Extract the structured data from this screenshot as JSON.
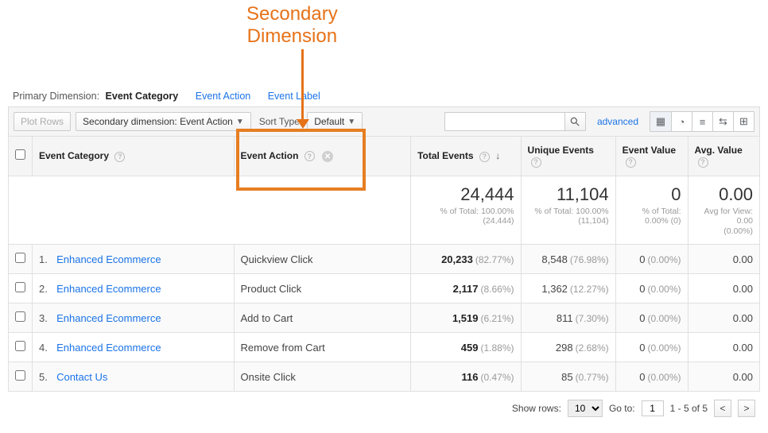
{
  "annotation": {
    "line1": "Secondary",
    "line2": "Dimension"
  },
  "primary": {
    "label": "Primary Dimension:",
    "active": "Event Category",
    "options": [
      "Event Action",
      "Event Label"
    ]
  },
  "toolbar": {
    "plot_rows": "Plot Rows",
    "secondary_dim": "Secondary dimension: Event Action",
    "sort_label": "Sort Type:",
    "sort_value": "Default",
    "search_placeholder": "",
    "advanced": "advanced"
  },
  "columns": [
    "Event Category",
    "Event Action",
    "Total Events",
    "Unique Events",
    "Event Value",
    "Avg. Value"
  ],
  "totals": {
    "total_events": {
      "value": "24,444",
      "sub1": "% of Total: 100.00%",
      "sub2": "(24,444)"
    },
    "unique_events": {
      "value": "11,104",
      "sub1": "% of Total: 100.00%",
      "sub2": "(11,104)"
    },
    "event_value": {
      "value": "0",
      "sub1": "% of Total:",
      "sub2": "0.00% (0)"
    },
    "avg_value": {
      "value": "0.00",
      "sub1": "Avg for View: 0.00",
      "sub2": "(0.00%)"
    }
  },
  "rows": [
    {
      "idx": "1.",
      "category": "Enhanced Ecommerce",
      "action": "Quickview Click",
      "total": "20,233",
      "total_pct": "(82.77%)",
      "unique": "8,548",
      "unique_pct": "(76.98%)",
      "ev": "0",
      "ev_pct": "(0.00%)",
      "avg": "0.00"
    },
    {
      "idx": "2.",
      "category": "Enhanced Ecommerce",
      "action": "Product Click",
      "total": "2,117",
      "total_pct": "(8.66%)",
      "unique": "1,362",
      "unique_pct": "(12.27%)",
      "ev": "0",
      "ev_pct": "(0.00%)",
      "avg": "0.00"
    },
    {
      "idx": "3.",
      "category": "Enhanced Ecommerce",
      "action": "Add to Cart",
      "total": "1,519",
      "total_pct": "(6.21%)",
      "unique": "811",
      "unique_pct": "(7.30%)",
      "ev": "0",
      "ev_pct": "(0.00%)",
      "avg": "0.00"
    },
    {
      "idx": "4.",
      "category": "Enhanced Ecommerce",
      "action": "Remove from Cart",
      "total": "459",
      "total_pct": "(1.88%)",
      "unique": "298",
      "unique_pct": "(2.68%)",
      "ev": "0",
      "ev_pct": "(0.00%)",
      "avg": "0.00"
    },
    {
      "idx": "5.",
      "category": "Contact Us",
      "action": "Onsite Click",
      "total": "116",
      "total_pct": "(0.47%)",
      "unique": "85",
      "unique_pct": "(0.77%)",
      "ev": "0",
      "ev_pct": "(0.00%)",
      "avg": "0.00"
    }
  ],
  "pager": {
    "show_rows_label": "Show rows:",
    "rows_per_page": "10",
    "goto_label": "Go to:",
    "goto_value": "1",
    "range": "1 - 5 of 5"
  }
}
